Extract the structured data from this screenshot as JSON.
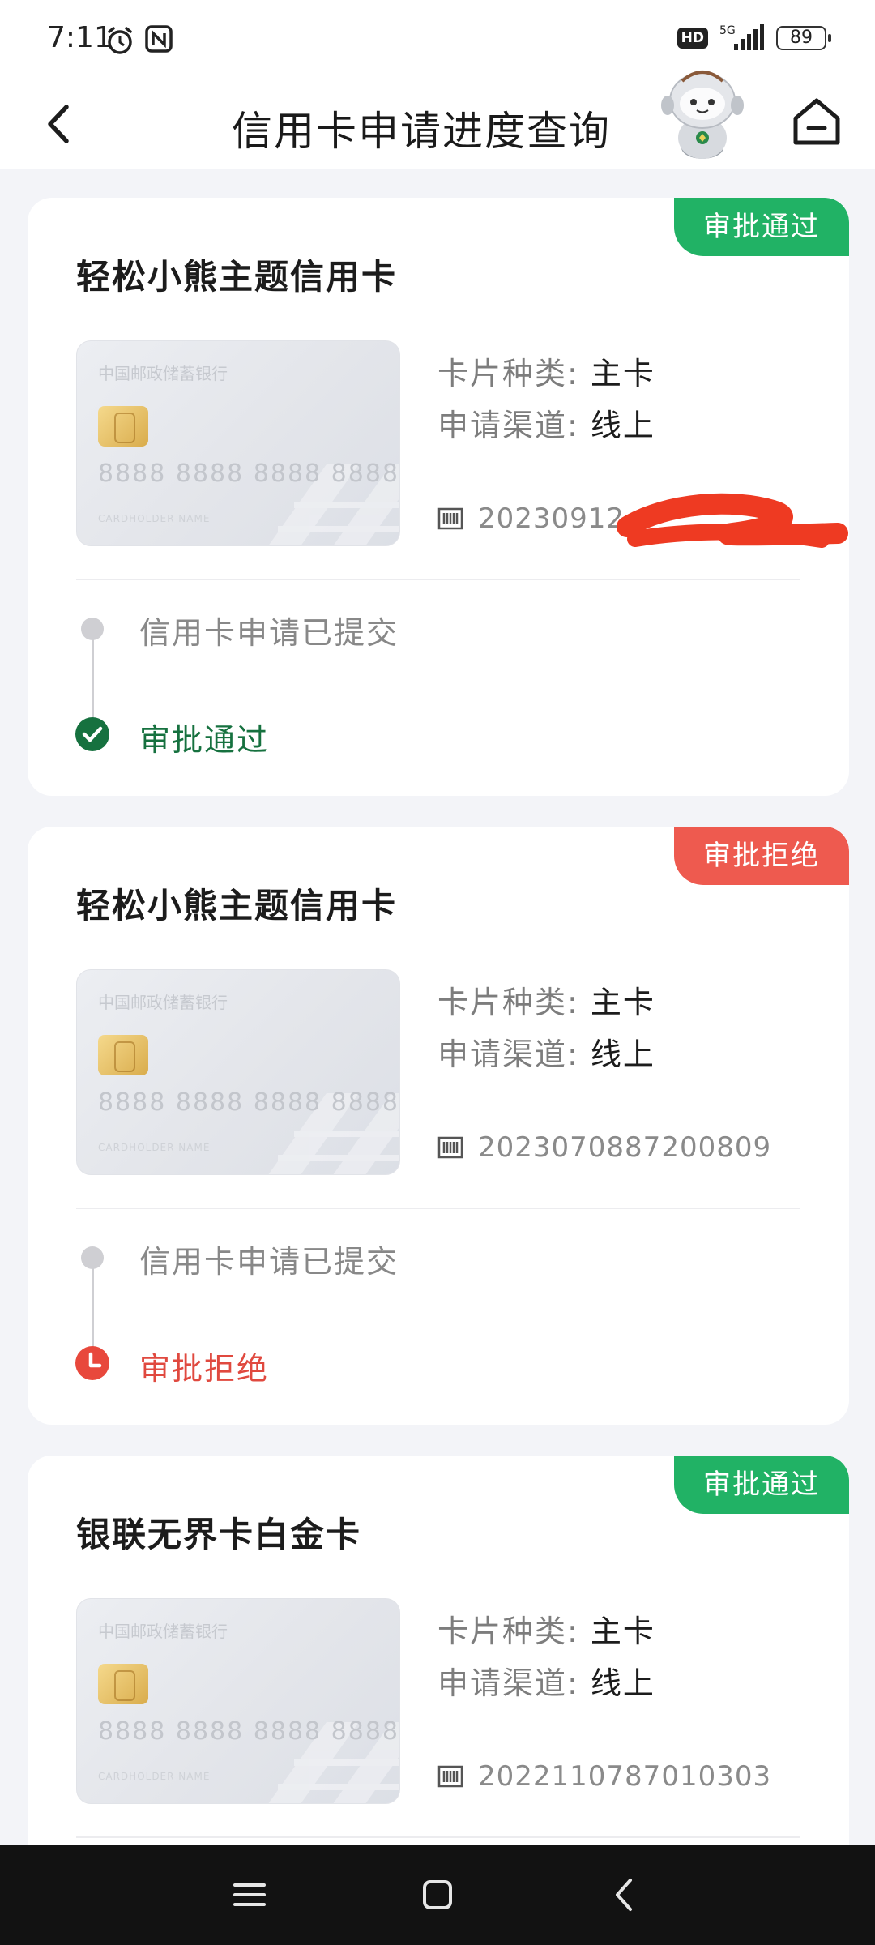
{
  "status_bar": {
    "time": "7:11",
    "network": "5G",
    "hd": "HD",
    "battery": "89"
  },
  "header": {
    "title": "信用卡申请进度查询"
  },
  "cards": [
    {
      "status": "审批通过",
      "status_type": "approved",
      "title": "轻松小熊主题信用卡",
      "card_image": {
        "bank": "中国邮政储蓄银行",
        "number": "8888 8888 8888 8888",
        "cardholder": "CARDHOLDER NAME"
      },
      "type_label": "卡片种类:",
      "type_value": "主卡",
      "channel_label": "申请渠道:",
      "channel_value": "线上",
      "application_no": "20230912",
      "step1": "信用卡申请已提交",
      "step2": "审批通过"
    },
    {
      "status": "审批拒绝",
      "status_type": "rejected",
      "title": "轻松小熊主题信用卡",
      "card_image": {
        "bank": "中国邮政储蓄银行",
        "number": "8888 8888 8888 8888",
        "cardholder": "CARDHOLDER NAME"
      },
      "type_label": "卡片种类:",
      "type_value": "主卡",
      "channel_label": "申请渠道:",
      "channel_value": "线上",
      "application_no": "2023070887200809",
      "step1": "信用卡申请已提交",
      "step2": "审批拒绝"
    },
    {
      "status": "审批通过",
      "status_type": "approved",
      "title": "银联无界卡白金卡",
      "card_image": {
        "bank": "中国邮政储蓄银行",
        "number": "8888 8888 8888 8888",
        "cardholder": "CARDHOLDER NAME"
      },
      "type_label": "卡片种类:",
      "type_value": "主卡",
      "channel_label": "申请渠道:",
      "channel_value": "线上",
      "application_no": "2022110787010303"
    }
  ],
  "colors": {
    "approved": "#21b265",
    "rejected": "#ee5a4f",
    "approved_text": "#16713f"
  },
  "icons": [
    "back-arrow-icon",
    "mascot-icon",
    "home-icon",
    "barcode-icon",
    "check-icon",
    "clock-icon",
    "menu-icon",
    "square-icon",
    "back-nav-icon"
  ]
}
